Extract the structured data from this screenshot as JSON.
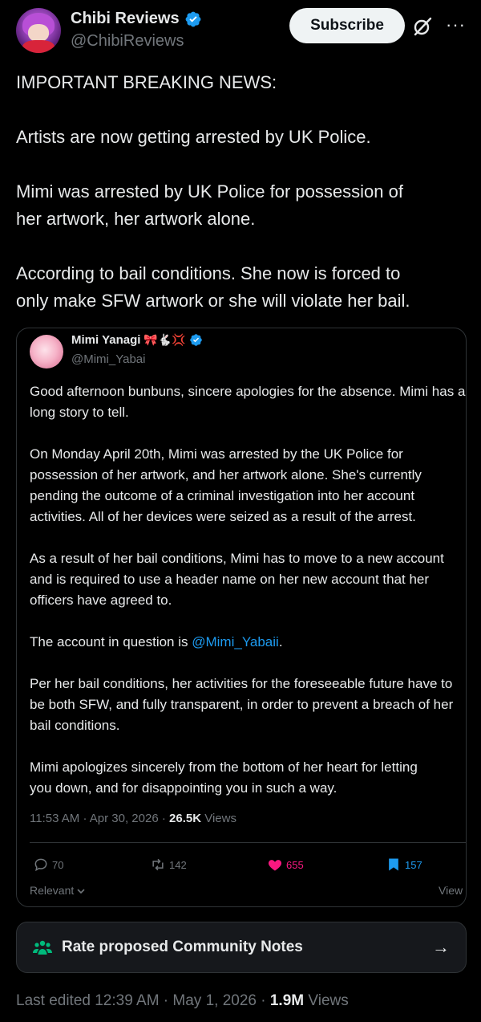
{
  "author": {
    "display_name": "Chibi Reviews",
    "handle": "@ChibiReviews",
    "verified": true
  },
  "header": {
    "subscribe_label": "Subscribe",
    "icons": [
      "grok-icon",
      "more-icon"
    ],
    "more_glyph": "···"
  },
  "post": {
    "paragraphs": [
      "IMPORTANT BREAKING NEWS:",
      "Artists are now getting arrested by UK Police.",
      "Mimi was arrested by UK Police for possession of",
      "her artwork, her artwork alone.",
      "According to bail conditions. She now is forced to",
      "only make SFW artwork or she will violate her bail."
    ]
  },
  "quote": {
    "display_name": "Mimi Yanagi",
    "name_emoji": "🎀🐇💢",
    "handle": "@Mimi_Yabai",
    "lines": [
      "Good afternoon bunbuns, sincere apologies for the absence. Mimi has a",
      "long story to tell.",
      "On Monday April 20th, Mimi was arrested by the UK Police for",
      "possession of her artwork, and her artwork alone. She's currently",
      "pending the outcome of a criminal investigation into her account",
      "activities. All of her devices were seized as a result of the arrest.",
      "As a result of her bail conditions, Mimi has to move to a new account",
      "and is required to use a header name on her new account that her",
      "officers have agreed to.",
      "The account in question is ",
      "@Mimi_Yabaii",
      ".",
      "Per her bail conditions, her activities for the foreseeable future have to",
      "be both SFW, and fully transparent, in order to prevent a breach of her",
      "bail conditions.",
      "Mimi apologizes sincerely from the bottom of her heart for letting",
      "you down, and for disappointing you in such a way."
    ],
    "meta": {
      "time": "11:53 AM",
      "date": "Apr 30, 2026",
      "views_count": "26.5K",
      "views_label": "Views"
    },
    "stats": {
      "replies": "70",
      "reposts": "142",
      "likes": "655",
      "bookmarks": "157"
    },
    "sort_label": "Relevant",
    "view_label": "View"
  },
  "community_notes": {
    "label": "Rate proposed Community Notes",
    "arrow": "→"
  },
  "footer": {
    "edited_prefix": "Last edited 12:39 AM · May 1, 2026 · ",
    "views_count": "1.9M",
    "views_label": "Views"
  },
  "colors": {
    "background": "#000000",
    "text": "#e7e9ea",
    "muted": "#71767b",
    "accent": "#1d9bf0",
    "like": "#f91880",
    "border": "#2f3336"
  }
}
